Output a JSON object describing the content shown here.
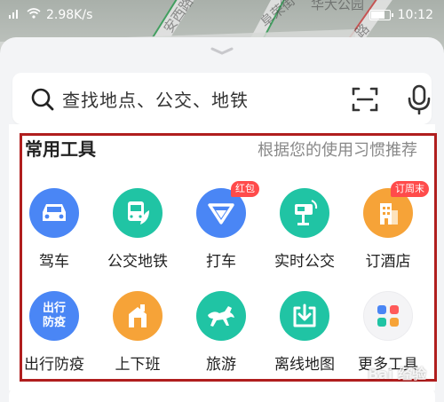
{
  "status_bar": {
    "network_speed": "2.98K/s",
    "time": "10:12"
  },
  "map": {
    "labels": [
      "安西路",
      "阜荣街",
      "华大公园",
      "路"
    ]
  },
  "search": {
    "placeholder": "查找地点、公交、地铁"
  },
  "tools": {
    "title": "常用工具",
    "subtitle": "根据您的使用习惯推荐",
    "items": [
      {
        "label": "驾车",
        "icon": "car-icon",
        "color": "#4a86f5"
      },
      {
        "label": "公交地铁",
        "icon": "bus-icon",
        "color": "#20c4a4"
      },
      {
        "label": "打车",
        "icon": "taxi-icon",
        "color": "#4a86f5",
        "badge": "红包"
      },
      {
        "label": "实时公交",
        "icon": "bus-stop-icon",
        "color": "#20c4a4"
      },
      {
        "label": "订酒店",
        "icon": "hotel-icon",
        "color": "#f6a338",
        "badge": "订周末"
      },
      {
        "label": "出行防疫",
        "icon": "epidemic-icon",
        "color": "#4a86f5",
        "icon_text": "出行\n防疫"
      },
      {
        "label": "上下班",
        "icon": "commute-icon",
        "color": "#f6a338"
      },
      {
        "label": "旅游",
        "icon": "horse-icon",
        "color": "#20c4a4"
      },
      {
        "label": "离线地图",
        "icon": "offline-map-icon",
        "color": "#20c4a4"
      },
      {
        "label": "更多工具",
        "icon": "more-tools-icon",
        "color": "#f4f4f6"
      }
    ]
  },
  "watermark": "Bai 经验"
}
